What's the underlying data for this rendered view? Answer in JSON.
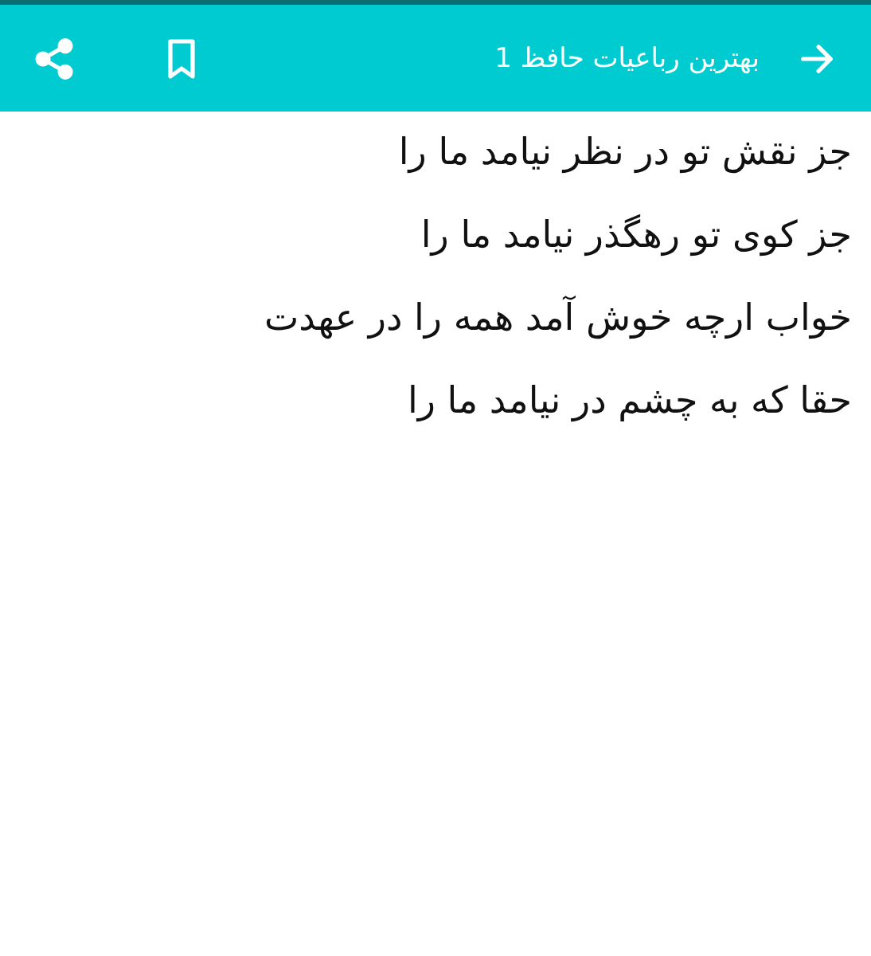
{
  "app_bar": {
    "title": "بهترین رباعیات حافظ 1"
  },
  "poem": {
    "lines": [
      "جز نقش تو در نظر نیامد ما را",
      "جز کوی تو رهگذر نیامد ما را",
      "خواب ارچه خوش آمد همه را در عهدت",
      "حقا که به چشم در نیامد ما را"
    ]
  }
}
